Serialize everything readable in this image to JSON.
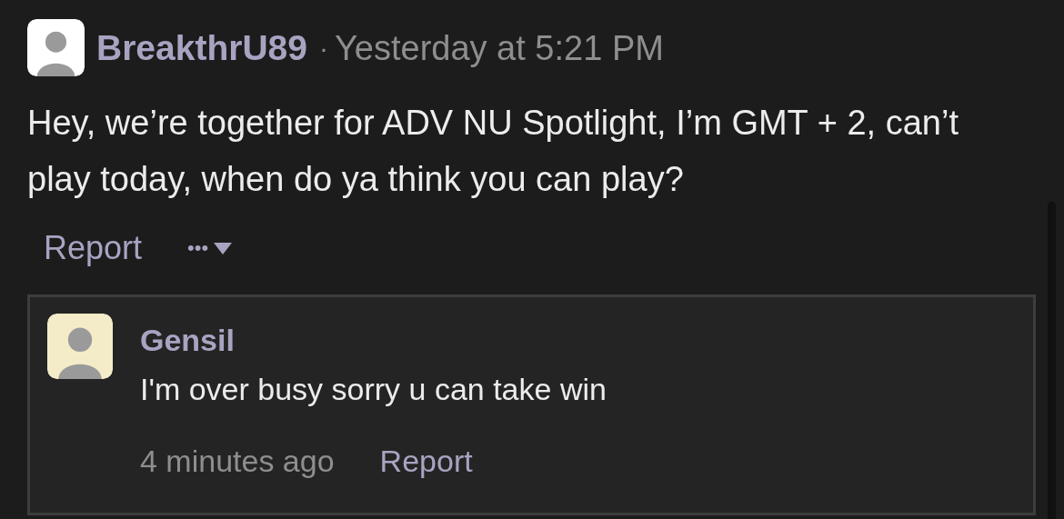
{
  "post": {
    "author": "BreakthrU89",
    "separator": "·",
    "time": "Yesterday at 5:21 PM",
    "body": "Hey, we’re together for ADV NU Spotlight, I’m GMT + 2, can’t play today, when do ya think you can play?",
    "actions": {
      "report": "Report",
      "more": "•••"
    }
  },
  "replies": [
    {
      "author": "Gensil",
      "body": "I'm over busy sorry u can take win",
      "time": "4 minutes ago",
      "report": "Report"
    }
  ]
}
